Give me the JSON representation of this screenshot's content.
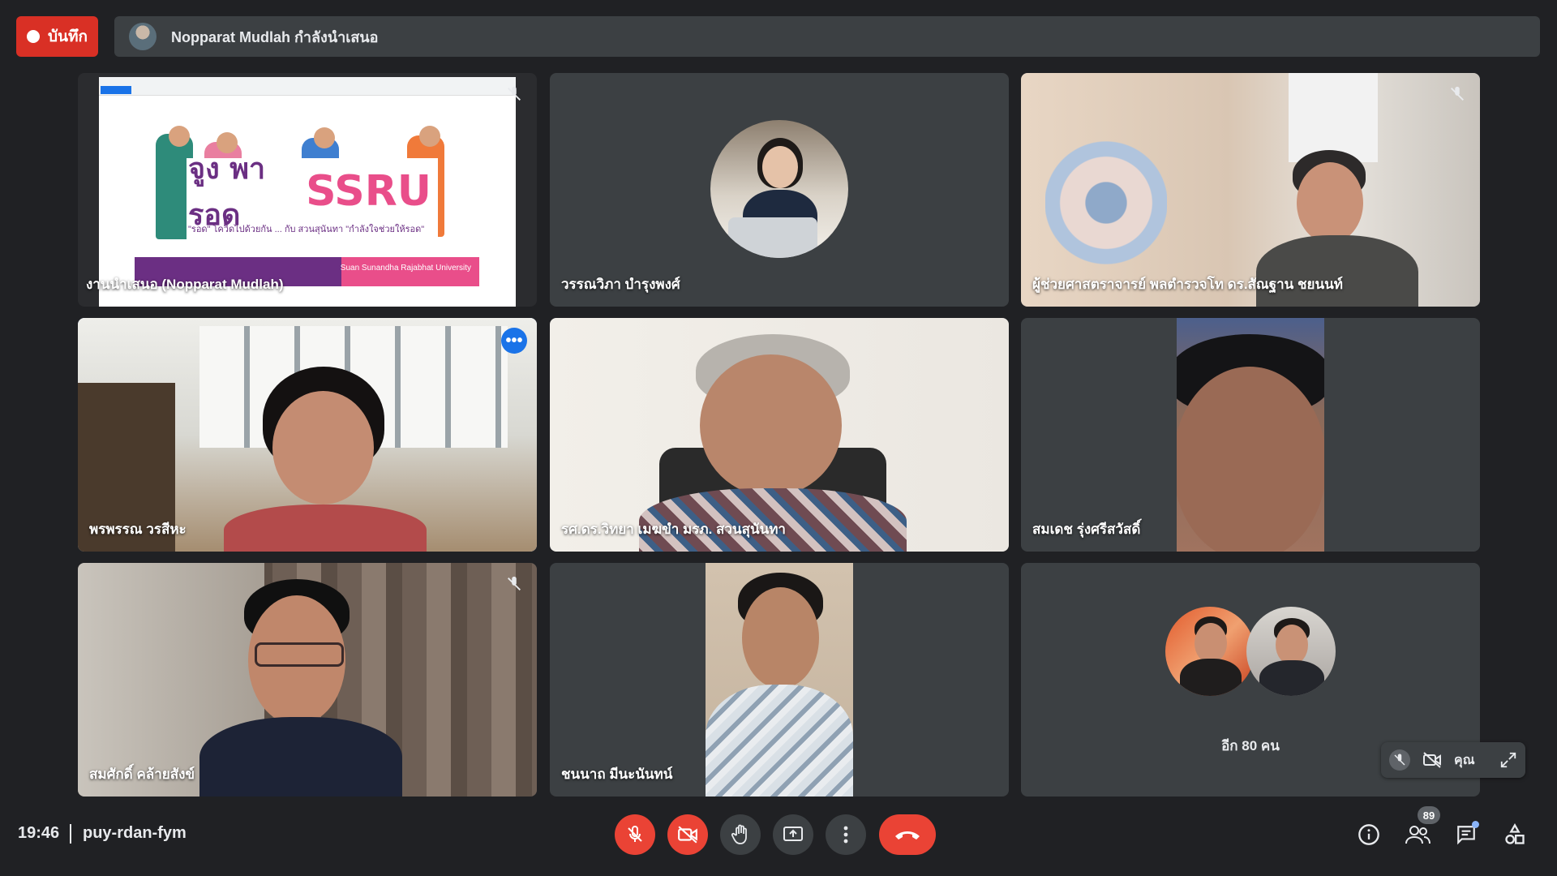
{
  "recording": {
    "label": "บันทึก"
  },
  "presenter_bar": {
    "text": "Nopparat Mudlah กำลังนำเสนอ"
  },
  "tiles": [
    {
      "name": "งานนำเสนอ (Nopparat Mudlah)",
      "muted": true
    },
    {
      "name": "วรรณวิภา บำรุงพงศ์",
      "muted": false
    },
    {
      "name": "ผู้ช่วยศาสตราจารย์ พลตำรวจโท ดร.สัณฐาน ชยนนท์",
      "muted": true
    },
    {
      "name": "พรพรรณ วรสีหะ",
      "muted": false,
      "active": true
    },
    {
      "name": "รศ.ดร.วิทยา เมฆขำ มรภ. สวนสุนันทา",
      "muted": false
    },
    {
      "name": "สมเดช รุ่งศรีสวัสดิ์",
      "muted": false
    },
    {
      "name": "สมศักดิ์ คล้ายสังข์",
      "muted": true
    },
    {
      "name": "ชนนาถ มีนะนันทน์",
      "muted": false
    },
    {
      "name": "",
      "more_count": "อีก 80 คน"
    }
  ],
  "slide": {
    "title_thai": "จูง พารอด",
    "title_brand": "SSRU",
    "subtitle": "\"รอด\" โควิดไปด้วยกัน ... กับ สวนสุนันทา \"กำลังใจช่วยให้รอด\"",
    "footer_text": "Suan Sunandha Rajabhat University"
  },
  "self_view": {
    "label": "คุณ"
  },
  "bottom": {
    "time": "19:46",
    "meeting_code": "puy-rdan-fym",
    "participants_count": "89"
  },
  "colors": {
    "background": "#202124",
    "tile": "#3c4043",
    "danger": "#ea4335",
    "active_outline": "#8ab4f8",
    "accent": "#1a73e8"
  }
}
